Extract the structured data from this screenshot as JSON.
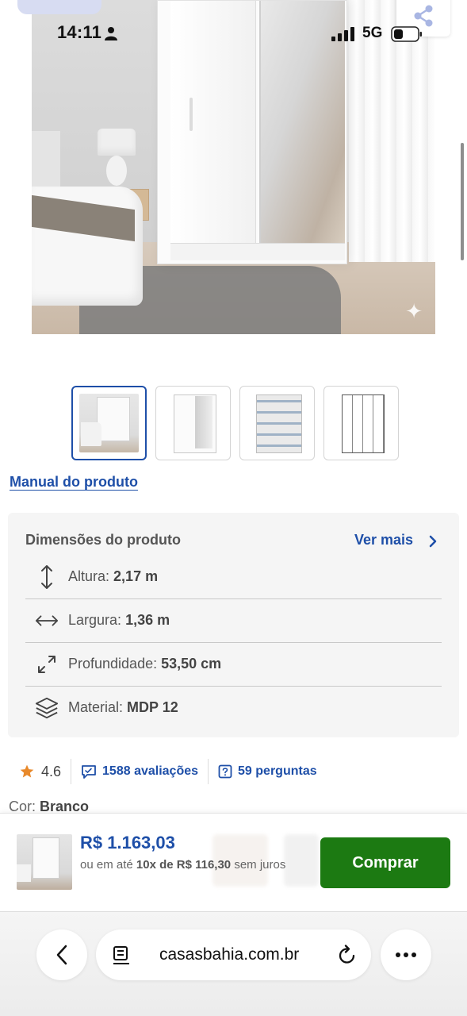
{
  "status_bar": {
    "time": "14:11",
    "network": "5G"
  },
  "product_gallery": {
    "thumbnails": [
      "ambiente",
      "frontal",
      "interno",
      "desenho-tecnico"
    ],
    "active_index": 0
  },
  "manual_link": "Manual do produto",
  "dimensions": {
    "title": "Dimensões do produto",
    "ver_mais": "Ver mais",
    "rows": [
      {
        "icon": "height-arrows-icon",
        "label": "Altura:",
        "value": "2,17 m"
      },
      {
        "icon": "width-arrows-icon",
        "label": "Largura:",
        "value": "1,36 m"
      },
      {
        "icon": "depth-arrows-icon",
        "label": "Profundidade:",
        "value": "53,50 cm"
      },
      {
        "icon": "layers-icon",
        "label": "Material:",
        "value": "MDP 12"
      }
    ]
  },
  "rating": {
    "score": "4.6",
    "reviews": "1588 avaliações",
    "questions": "59 perguntas"
  },
  "color": {
    "label": "Cor:",
    "value": "Branco"
  },
  "buy_bar": {
    "price": "R$ 1.163,03",
    "install_prefix": "ou em até",
    "install_detail": "10x de R$ 116,30",
    "install_suffix": "sem juros",
    "button": "Comprar"
  },
  "browser": {
    "domain": "casasbahia.com.br"
  },
  "colors": {
    "brand_blue": "#1e4fa8",
    "buy_green": "#1c7a12",
    "star": "#e8892b"
  }
}
